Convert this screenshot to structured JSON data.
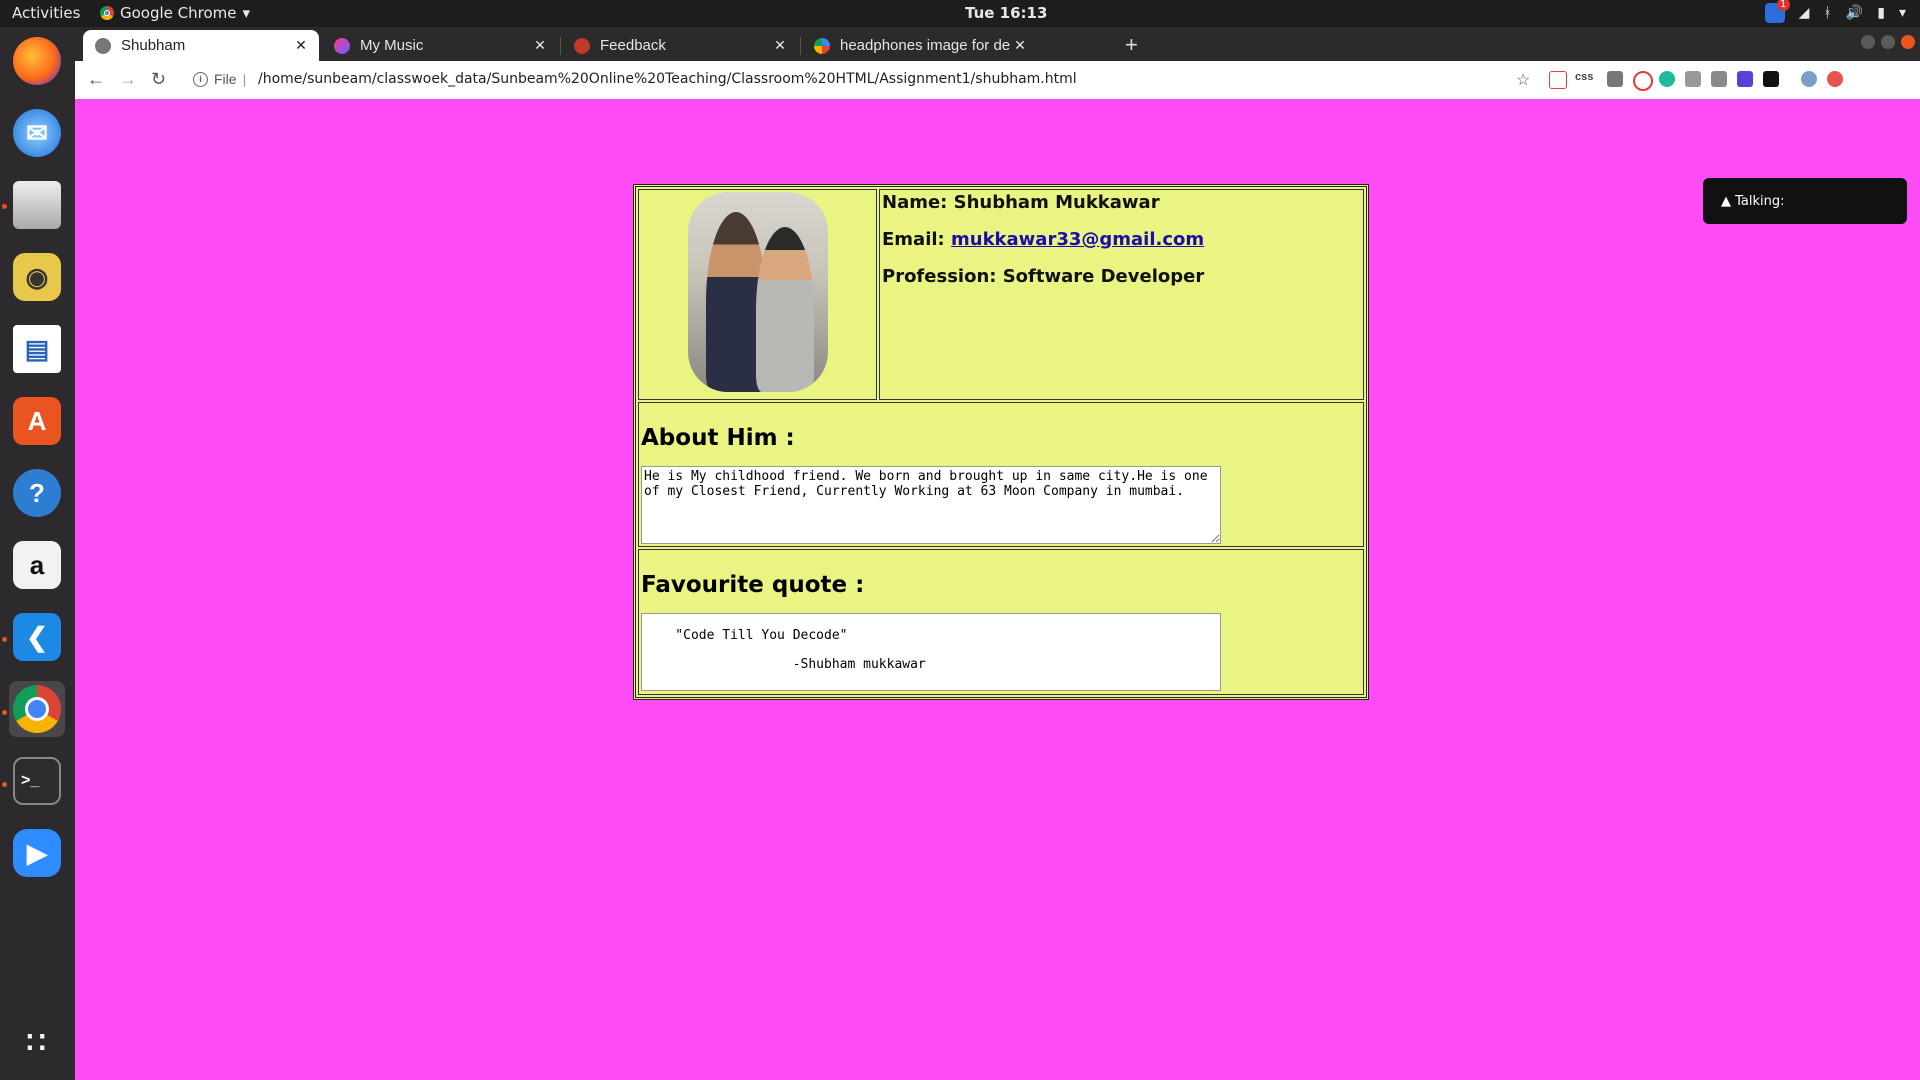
{
  "topbar": {
    "activities": "Activities",
    "app_name": "Google Chrome",
    "app_caret": "▾",
    "clock": "Tue 16:13",
    "notif_count": "1",
    "tray_icons": [
      "wifi-icon",
      "bluetooth-icon",
      "volume-icon",
      "battery-icon",
      "menu-caret-icon"
    ]
  },
  "dock": {
    "items": [
      "firefox-icon",
      "thunderbird-icon",
      "files-icon",
      "rhythmbox-icon",
      "writer-icon",
      "software-center-icon",
      "help-icon",
      "amazon-icon",
      "vscode-icon",
      "chrome-icon",
      "terminal-icon",
      "zoom-icon"
    ],
    "apps_grid_icon": "apps-grid-icon"
  },
  "browser": {
    "tabs": [
      {
        "title": "Shubham",
        "active": true
      },
      {
        "title": "My Music",
        "active": false
      },
      {
        "title": "Feedback",
        "active": false
      },
      {
        "title": "headphones image for de",
        "active": false
      }
    ],
    "new_tab": "+",
    "secure_label": "File",
    "url": "/home/sunbeam/classwoek_data/Sunbeam%20Online%20Teaching/Classroom%20HTML/Assignment1/shubham.html",
    "ext_css_label": "css"
  },
  "page": {
    "background": "#ff4cf7",
    "card_background": "#eaf483",
    "name_label": "Name: Shubham Mukkawar",
    "email_label": "Email: ",
    "email_value": "mukkawar33@gmail.com",
    "profession_label": "Profession: Software Developer",
    "about_title": "About Him :",
    "about_text": "He is My childhood friend. We born and brought up in same city.He is one of my Closest Friend, Currently Working at 63 Moon Company in mumbai.",
    "quote_title": "Favourite quote :",
    "quote_line1": "    \"Code Till You Decode\"",
    "quote_line2": "                   -Shubham mukkawar"
  },
  "overlay": {
    "talking_label": "▲ Talking:"
  }
}
